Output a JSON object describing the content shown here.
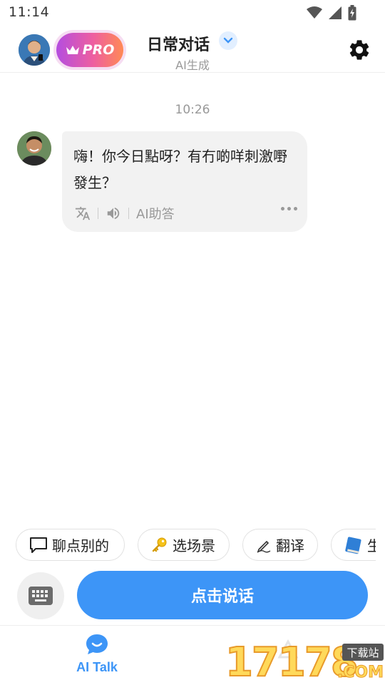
{
  "status_bar": {
    "time": "11:14",
    "icons": [
      "wifi-icon",
      "signal-icon",
      "battery-charging-icon"
    ]
  },
  "header": {
    "pro_label": "PRO",
    "title": "日常对话",
    "subtitle": "AI生成",
    "icons": [
      "user-avatar",
      "crown-icon",
      "chevron-down-icon",
      "gear-icon"
    ]
  },
  "chat": {
    "timestamp": "10:26",
    "messages": [
      {
        "sender": "ai",
        "text": "嗨！你今日點呀？有冇啲咩刺激嘢發生？",
        "tools": {
          "translate_icon": "translate-icon",
          "speaker_icon": "speaker-icon",
          "assist_label": "AI助答",
          "more_icon": "more-icon"
        }
      }
    ]
  },
  "chips": [
    {
      "icon": "speech-bubble-icon",
      "label": "聊点别的"
    },
    {
      "icon": "key-icon",
      "label": "选场景"
    },
    {
      "icon": "pen-icon",
      "label": "翻译"
    },
    {
      "icon": "book-icon",
      "label": "生"
    }
  ],
  "input": {
    "keyboard_icon": "keyboard-icon",
    "speak_label": "点击说话"
  },
  "bottom_nav": {
    "items": [
      {
        "label": "AI Talk",
        "icon": "chat-icon",
        "active": true
      },
      {
        "label": "",
        "icon": "faded-icon",
        "active": false
      }
    ]
  },
  "watermark": {
    "digits": "17178",
    "tag": "下载站",
    "suffix": ".COM"
  },
  "colors": {
    "accent": "#3d95f7",
    "bubble": "#f2f2f2",
    "pro_gradient_start": "#b44de0",
    "pro_gradient_end": "#ff8a55"
  }
}
